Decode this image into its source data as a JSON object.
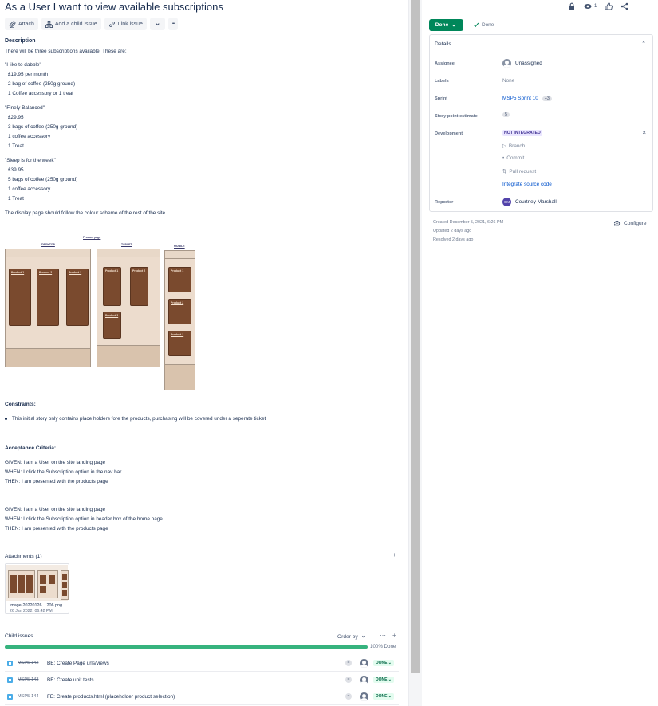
{
  "issue": {
    "title": "As a User I want to view available subscriptions"
  },
  "toolbar": {
    "attach": "Attach",
    "add_child": "Add a child issue",
    "link_issue": "Link issue",
    "more": "•••"
  },
  "description": {
    "heading": "Description",
    "intro": "There will be three subscriptions available. These are:",
    "plans": [
      {
        "name": "\"I like to dabble\"",
        "items": [
          "£19.95 per month",
          "2 bag of coffee (250g ground)",
          "1 Coffee accessory or 1 treat"
        ]
      },
      {
        "name": "\"Finely Balanced\"",
        "items": [
          "£29.95",
          "3 bags of coffee (250g ground)",
          "1 coffee accessory",
          "1 Treat"
        ]
      },
      {
        "name": "\"Sleep is for the week\"",
        "items": [
          "£39.95",
          "5 bags of coffee (250g ground)",
          "1 coffee accessory",
          "1 Treat"
        ]
      }
    ],
    "display_note": "The display page should follow the colour scheme of the rest of the site."
  },
  "mockup": {
    "title": "Product page",
    "desktop_label": "DESKTOP",
    "tablet_label": "TABLET",
    "mobile_label": "MOBILE",
    "card1": "Product 1",
    "card2": "Product 2",
    "card3": "Product 3"
  },
  "constraints": {
    "heading": "Constraints:",
    "items": [
      "This initial story only contains place holders fore the products, purchasing will be covered under a seperate ticket"
    ]
  },
  "acceptance": {
    "heading": "Acceptance Criteria:",
    "scenario1": [
      "GIVEN: I am a User on the site landing page",
      "WHEN: I click the Subscription option in the nav bar",
      "THEN: I am presented with the products page"
    ],
    "scenario2": [
      "GIVEN: I am a User on the site landing page",
      "WHEN: I click the Subscription option in header box of the home page",
      "THEN: I am presented with the products page"
    ]
  },
  "attachments": {
    "heading": "Attachments (1)",
    "file_name": "image-20220126... 206.png",
    "file_date": "26 Jan 2022, 06:42 PM"
  },
  "child_issues": {
    "heading": "Child issues",
    "order_by": "Order by",
    "progress_percent": 100,
    "progress_label": "100% Done",
    "rows": [
      {
        "key": "MSP5-142",
        "summary": "BE: Create Page urls/views",
        "status": "DONE"
      },
      {
        "key": "MSP5-143",
        "summary": "BE: Create unit tests",
        "status": "DONE"
      },
      {
        "key": "MSP5-144",
        "summary": "FE: Create products.html (placeholder product selection)",
        "status": "DONE"
      }
    ]
  },
  "top_actions": {
    "watch_count": "1"
  },
  "status": {
    "button_label": "Done",
    "resolution": "Done",
    "accent": "#00875a"
  },
  "details": {
    "heading": "Details",
    "assignee_label": "Assignee",
    "assignee_value": "Unassigned",
    "labels_label": "Labels",
    "labels_value": "None",
    "sprint_label": "Sprint",
    "sprint_value": "MSP5 Sprint 10",
    "sprint_extra": "+3",
    "estimate_label": "Story point estimate",
    "estimate_value": "5",
    "development_label": "Development",
    "development_badge": "NOT INTEGRATED",
    "branch": "Branch",
    "commit": "Commit",
    "pull_request": "Pull request",
    "integrate_link": "Integrate source code",
    "reporter_label": "Reporter",
    "reporter_initials": "CM",
    "reporter_name": "Courtney Marshall"
  },
  "meta": {
    "created": "Created December 5, 2021, 6:26 PM",
    "updated": "Updated 2 days ago",
    "resolved": "Resolved 2 days ago",
    "configure": "Configure"
  }
}
